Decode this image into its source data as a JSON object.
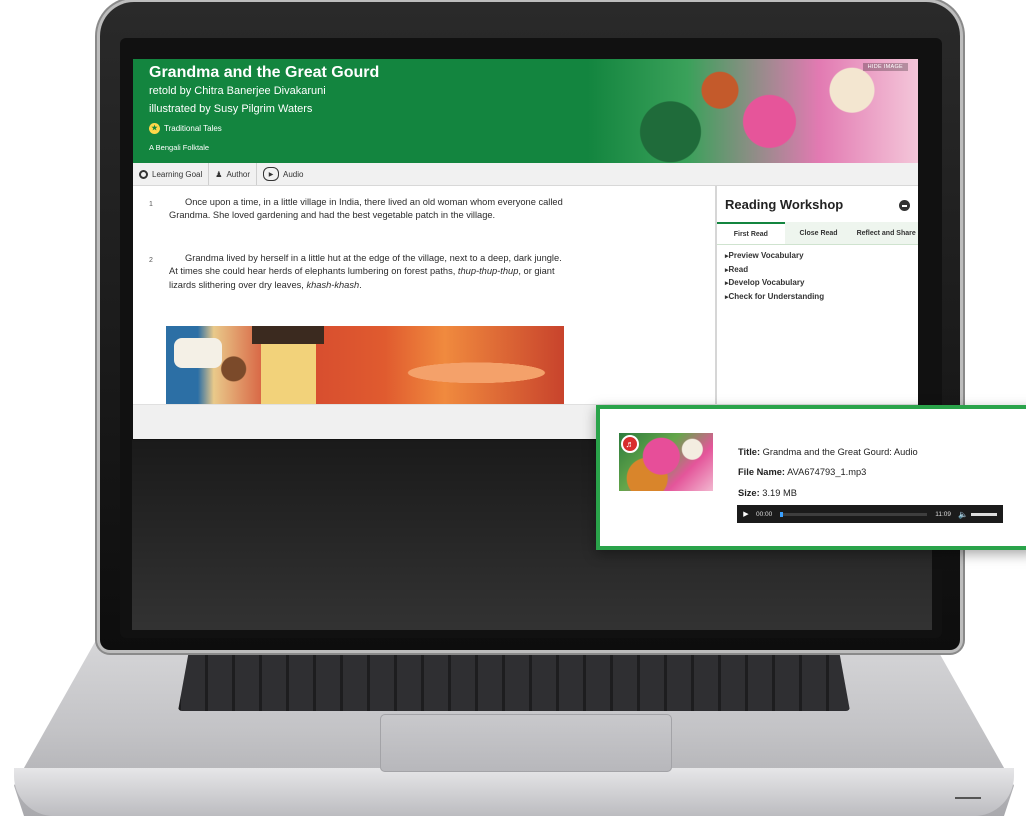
{
  "hero": {
    "title": "Grandma and the Great Gourd",
    "retold": "retold by Chitra Banerjee Divakaruni",
    "illustrated": "illustrated by Susy Pilgrim Waters",
    "genre": "Traditional Tales",
    "subgenre": "A Bengali Folktale",
    "hide_image": "HIDE IMAGE",
    "accent_color": "#13853f"
  },
  "toolbar": {
    "learning_goal": "Learning Goal",
    "author": "Author",
    "audio": "Audio"
  },
  "story": {
    "paragraphs": [
      {
        "number": "1",
        "text": "Once upon a time, in a little village in India, there lived an old woman whom everyone called Grandma. She loved gardening and had the best vegetable patch in the village."
      },
      {
        "number": "2",
        "text_a": "Grandma lived by herself in a little hut at the edge of the village, next to a deep, dark jungle. At times she could hear herds of elephants lumbering on forest paths, ",
        "text_italic_1": "thup-thup-thup",
        "text_b": ", or giant lizards slithering over dry leaves, ",
        "text_italic_2": "khash-khash",
        "text_c": "."
      }
    ]
  },
  "workshop": {
    "heading": "Reading Workshop",
    "tabs": [
      {
        "label": "First Read"
      },
      {
        "label": "Close Read"
      },
      {
        "label": "Reflect and Share"
      }
    ],
    "items": [
      "Preview Vocabulary",
      "Read",
      "Develop Vocabulary",
      "Check for Understanding"
    ]
  },
  "audio_card": {
    "title_label": "Title:",
    "title_value": "Grandma and the Great Gourd: Audio",
    "file_label": "File Name:",
    "file_value": "AVA674793_1.mp3",
    "size_label": "Size:",
    "size_value": "3.19 MB",
    "current_time": "00:00",
    "duration": "11:09",
    "progress": 0.02,
    "border_color": "#2aa34a"
  }
}
